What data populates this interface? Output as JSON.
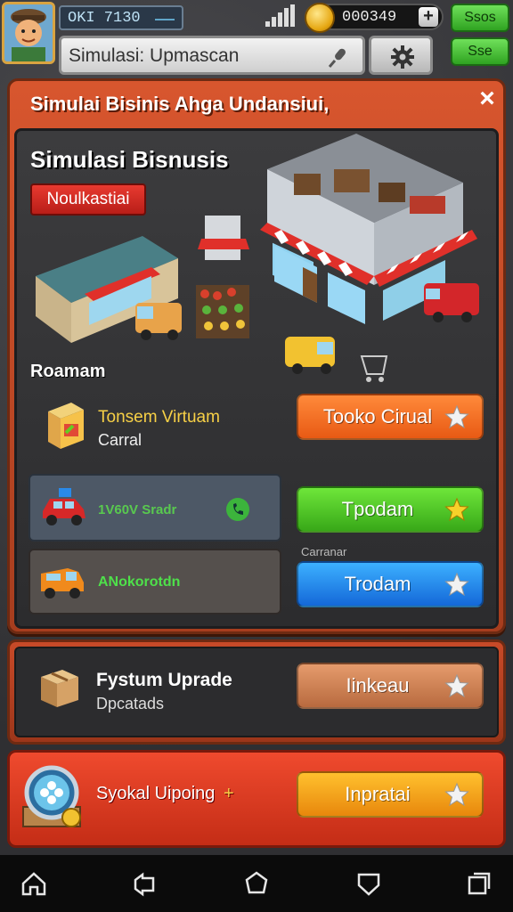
{
  "topbar": {
    "player_id": "OKI 7130",
    "coins": "000349",
    "plus": "+",
    "button_top": "Ssos",
    "button_bottom": "Sse",
    "search_text": "Simulasi: Upmascan"
  },
  "panel": {
    "title": "Simulai Bisinis Ahga Undansiui,",
    "close": "×",
    "inner_title": "Simulasi Bisnusis",
    "badge": "Noulkastiai",
    "section_label": "Roamam",
    "items": [
      {
        "title": "Tonsem Virtuam",
        "subtitle": "Carral",
        "button": "Tooko Cirual"
      },
      {
        "title": "1V60V Sradr",
        "button": "Tpodam"
      },
      {
        "title": "ANokorotdn",
        "button": "Trodam"
      }
    ],
    "small_label": "Carranar"
  },
  "upgrade": {
    "title": "Fystum Uprade",
    "subtitle": "Dpcatads",
    "button": "Iinkeau"
  },
  "special": {
    "title": "Syokal Uipoing",
    "plus": "+",
    "button": "Inpratai"
  },
  "colors": {
    "panel_red": "#d8562e",
    "orange_button": "#e85a14",
    "green_button": "#38a818",
    "blue_button": "#1468d8",
    "yellow_button": "#e8870c"
  },
  "icons": [
    "avatar",
    "signal-icon",
    "coin-icon",
    "mic-icon",
    "gear-icon",
    "close-icon",
    "star-icon",
    "box-icon",
    "car-icon",
    "van-icon",
    "chest-icon",
    "home-icon",
    "back-icon",
    "circle-icon",
    "shield-icon",
    "recent-icon"
  ]
}
